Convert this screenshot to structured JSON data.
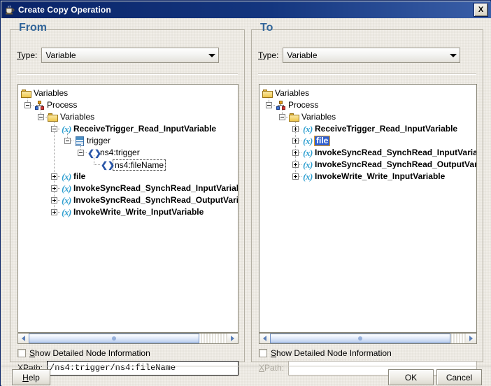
{
  "window": {
    "title": "Create Copy Operation",
    "icon": "java-coffee-cup-icon",
    "close_label": "X"
  },
  "from_panel": {
    "title": "From",
    "type_label_pre": "T",
    "type_label_mnemonic": "y",
    "type_label_post": "pe:",
    "type_label_full": "Type:",
    "type_value": "Variable",
    "checkbox_label_pre": "",
    "checkbox_label_mnemonic": "S",
    "checkbox_label_post": "how Detailed Node Information",
    "checkbox_label_full": "Show Detailed Node Information",
    "checkbox_checked": false,
    "xpath_label_mnemonic": "X",
    "xpath_label_post": "Path:",
    "xpath_label_full": "XPath:",
    "xpath_value": "/ns4:trigger/ns4:fileName",
    "xpath_enabled": true,
    "tree": [
      {
        "label": "Variables",
        "icon": "folder-icon",
        "depth": 0,
        "expander": "none",
        "bold": false,
        "selection": "none"
      },
      {
        "label": "Process",
        "icon": "process-icon",
        "depth": 1,
        "expander": "minus",
        "bold": false,
        "selection": "none"
      },
      {
        "label": "Variables",
        "icon": "folder-icon",
        "depth": 2,
        "expander": "minus",
        "bold": false,
        "selection": "none"
      },
      {
        "label": "ReceiveTrigger_Read_InputVariable",
        "icon": "variable-icon",
        "depth": 3,
        "expander": "minus",
        "bold": true,
        "selection": "none"
      },
      {
        "label": "trigger",
        "icon": "message-icon",
        "depth": 4,
        "expander": "minus",
        "bold": false,
        "selection": "none"
      },
      {
        "label": "ns4:trigger",
        "icon": "element-icon",
        "depth": 5,
        "expander": "minus",
        "bold": false,
        "selection": "none"
      },
      {
        "label": "ns4:fileName",
        "icon": "element-icon",
        "depth": 6,
        "expander": "none",
        "bold": false,
        "selection": "focus"
      },
      {
        "label": "file",
        "icon": "variable-icon",
        "depth": 3,
        "expander": "plus",
        "bold": true,
        "selection": "none"
      },
      {
        "label": "InvokeSyncRead_SynchRead_InputVariable",
        "icon": "variable-icon",
        "depth": 3,
        "expander": "plus",
        "bold": true,
        "selection": "none"
      },
      {
        "label": "InvokeSyncRead_SynchRead_OutputVariable",
        "icon": "variable-icon",
        "depth": 3,
        "expander": "plus",
        "bold": true,
        "selection": "none"
      },
      {
        "label": "InvokeWrite_Write_InputVariable",
        "icon": "variable-icon",
        "depth": 3,
        "expander": "plus",
        "bold": true,
        "selection": "none"
      }
    ]
  },
  "to_panel": {
    "title": "To",
    "type_label_full": "Type:",
    "type_value": "Variable",
    "checkbox_label_full": "Show Detailed Node Information",
    "checkbox_checked": false,
    "xpath_label_full": "XPath:",
    "xpath_value": "",
    "xpath_enabled": false,
    "tree": [
      {
        "label": "Variables",
        "icon": "folder-icon",
        "depth": 0,
        "expander": "none",
        "bold": false,
        "selection": "none"
      },
      {
        "label": "Process",
        "icon": "process-icon",
        "depth": 1,
        "expander": "minus",
        "bold": false,
        "selection": "none"
      },
      {
        "label": "Variables",
        "icon": "folder-icon",
        "depth": 2,
        "expander": "minus",
        "bold": false,
        "selection": "none"
      },
      {
        "label": "ReceiveTrigger_Read_InputVariable",
        "icon": "variable-icon",
        "depth": 3,
        "expander": "plus",
        "bold": true,
        "selection": "none"
      },
      {
        "label": "file",
        "icon": "variable-icon",
        "depth": 3,
        "expander": "plus",
        "bold": true,
        "selection": "selected"
      },
      {
        "label": "InvokeSyncRead_SynchRead_InputVariable",
        "icon": "variable-icon",
        "depth": 3,
        "expander": "plus",
        "bold": true,
        "selection": "none"
      },
      {
        "label": "InvokeSyncRead_SynchRead_OutputVariable",
        "icon": "variable-icon",
        "depth": 3,
        "expander": "plus",
        "bold": true,
        "selection": "none"
      },
      {
        "label": "InvokeWrite_Write_InputVariable",
        "icon": "variable-icon",
        "depth": 3,
        "expander": "plus",
        "bold": true,
        "selection": "none"
      }
    ]
  },
  "buttons": {
    "help_mnemonic": "H",
    "help_pre": "",
    "help_post": "elp",
    "help_label": "Help",
    "ok_label": "OK",
    "cancel_label": "Cancel"
  },
  "colors": {
    "titlebar": "#0a2468",
    "group_title": "#33669a",
    "panel_bg": "#ece9e2",
    "selection_blue": "#2f5fd0",
    "selection_border": "#e8a020",
    "variable_icon": "#2e9fd0",
    "element_icon": "#2956a8"
  }
}
